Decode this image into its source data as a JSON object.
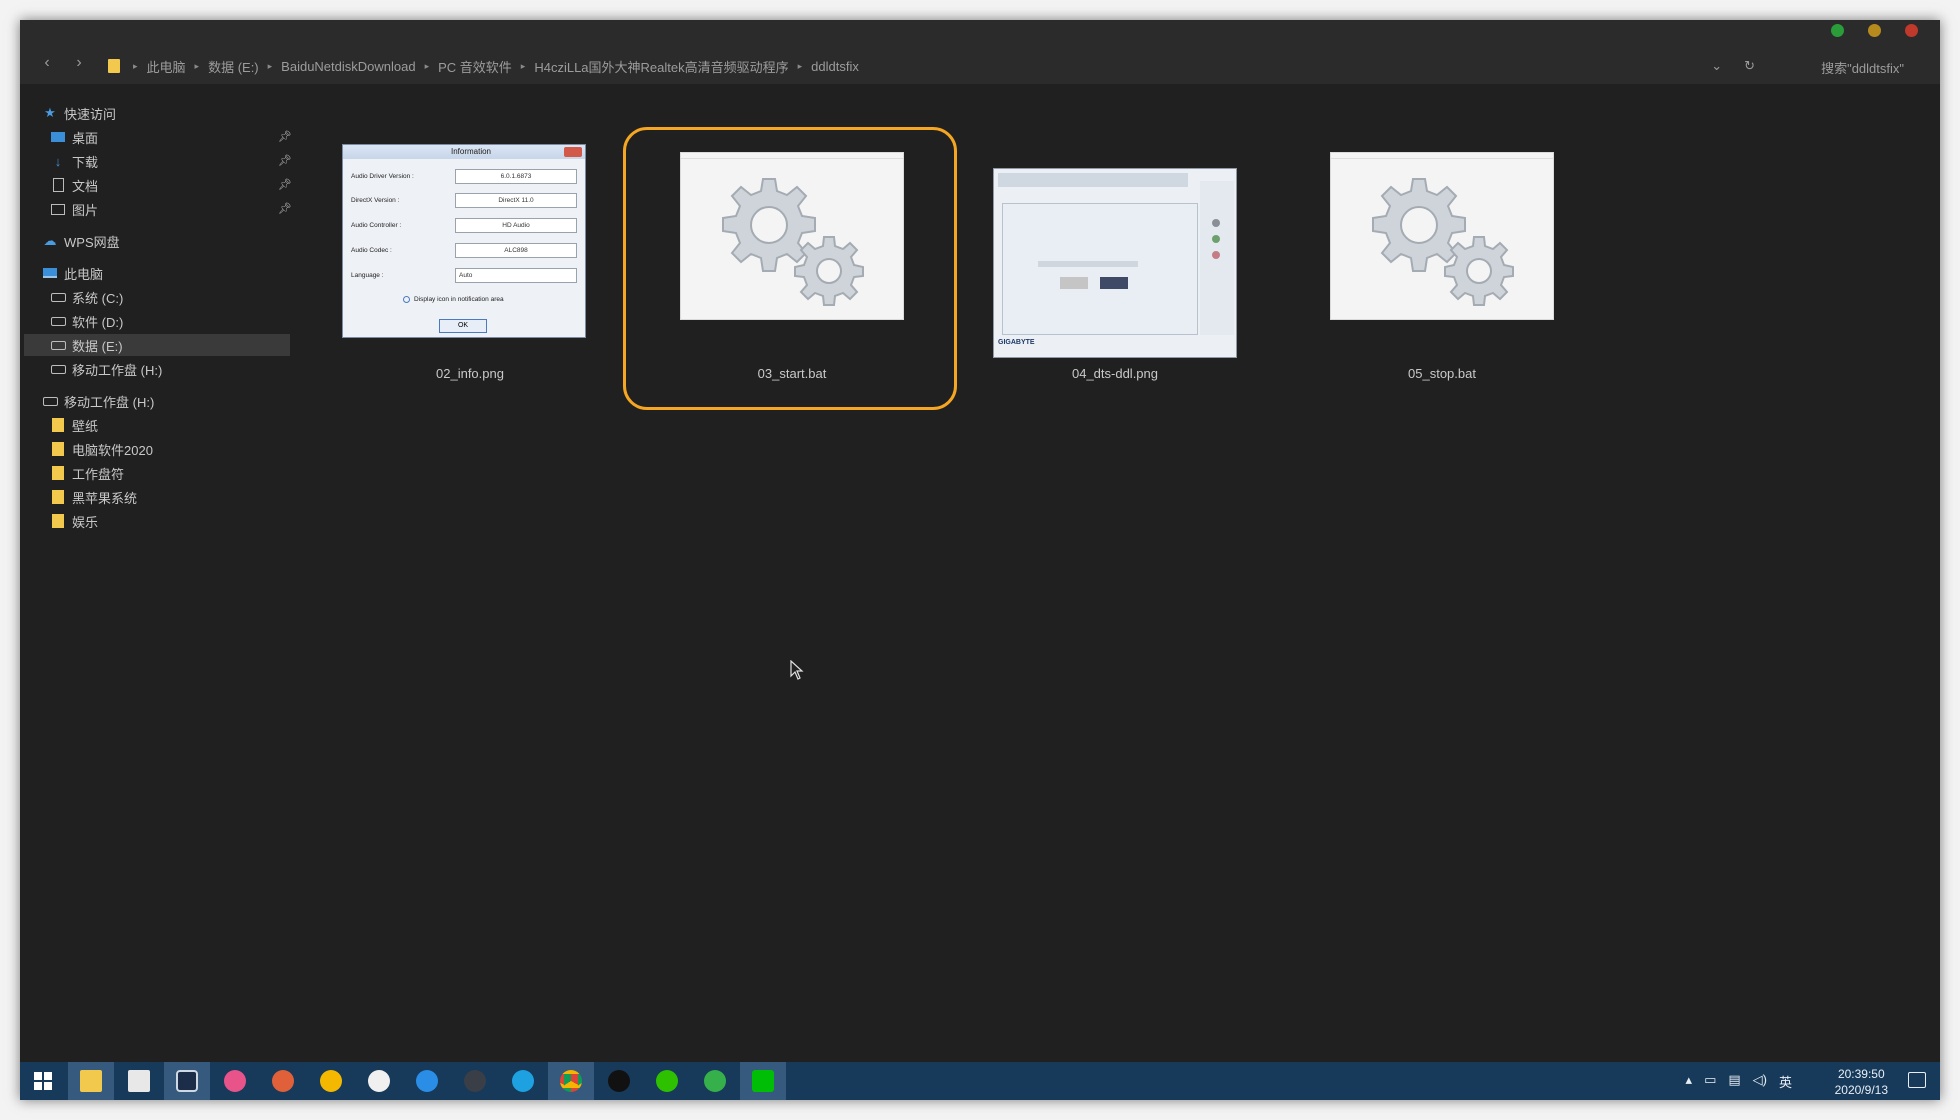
{
  "window": {
    "controls": {
      "min_color": "#2a9d3a",
      "max_color": "#b78a1e",
      "close_color": "#c0392b"
    },
    "nav": {
      "back": "‹",
      "forward": "›"
    },
    "breadcrumb": [
      "此电脑",
      "数据 (E:)",
      "BaiduNetdiskDownload",
      "PC 音效软件",
      "H4cziLLa国外大神Realtek高清音频驱动程序",
      "ddldtsfix"
    ],
    "search_placeholder": "搜索\"ddldtsfix\"",
    "dropdown_icon": "⌄",
    "refresh_icon": "↻"
  },
  "sidebar": {
    "quick_access": "快速访问",
    "quick_items": [
      "桌面",
      "下载",
      "文档",
      "图片"
    ],
    "wps": "WPS网盘",
    "this_pc": "此电脑",
    "drives": [
      "系统 (C:)",
      "软件 (D:)",
      "数据 (E:)",
      "移动工作盘 (H:)"
    ],
    "removable": "移动工作盘 (H:)",
    "folders": [
      "壁纸",
      "电脑软件2020",
      "工作盘符",
      "黑苹果系统",
      "娱乐"
    ]
  },
  "files": [
    {
      "name": "02_info.png",
      "kind": "image-info"
    },
    {
      "name": "03_start.bat",
      "kind": "bat",
      "selected": true
    },
    {
      "name": "04_dts-ddl.png",
      "kind": "image-realtek"
    },
    {
      "name": "05_stop.bat",
      "kind": "bat"
    }
  ],
  "info_dialog": {
    "title": "Information",
    "rows": [
      {
        "label": "Audio Driver Version :",
        "value": "6.0.1.6873"
      },
      {
        "label": "DirectX Version :",
        "value": "DirectX 11.0"
      },
      {
        "label": "Audio Controller :",
        "value": "HD Audio"
      },
      {
        "label": "Audio Codec :",
        "value": "ALC898"
      },
      {
        "label": "Language :",
        "value": "Auto"
      }
    ],
    "checkbox": "Display icon in notification area",
    "ok": "OK"
  },
  "realtek_thumb": {
    "brand": "GIGABYTE"
  },
  "taskbar": {
    "tray": {
      "ime": "英"
    },
    "time": "20:39:50",
    "date": "2020/9/13"
  }
}
